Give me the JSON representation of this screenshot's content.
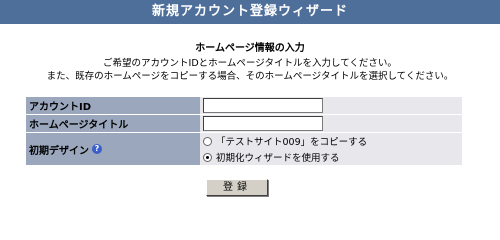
{
  "window": {
    "title": "新規アカウント登録ウィザード"
  },
  "intro": {
    "heading": "ホームページ情報の入力",
    "line1": "ご希望のアカウントIDとホームページタイトルを入力してください。",
    "line2": "また、既存のホームページをコピーする場合、そのホームページタイトルを選択してください。"
  },
  "form": {
    "account_id": {
      "label": "アカウントID",
      "value": ""
    },
    "homepage_title": {
      "label": "ホームページタイトル",
      "value": ""
    },
    "initial_design": {
      "label": "初期デザイン",
      "help_icon": "question-icon",
      "options": [
        {
          "label": "「テストサイト009」をコピーする",
          "checked": false
        },
        {
          "label": "初期化ウィザードを使用する",
          "checked": true
        }
      ]
    }
  },
  "actions": {
    "register_label": "登録"
  },
  "colors": {
    "titlebar": "#4f6f9b",
    "label_bg": "#9aa7bc",
    "value_bg": "#e8e8ec",
    "help_icon": "#3a5fc8"
  }
}
